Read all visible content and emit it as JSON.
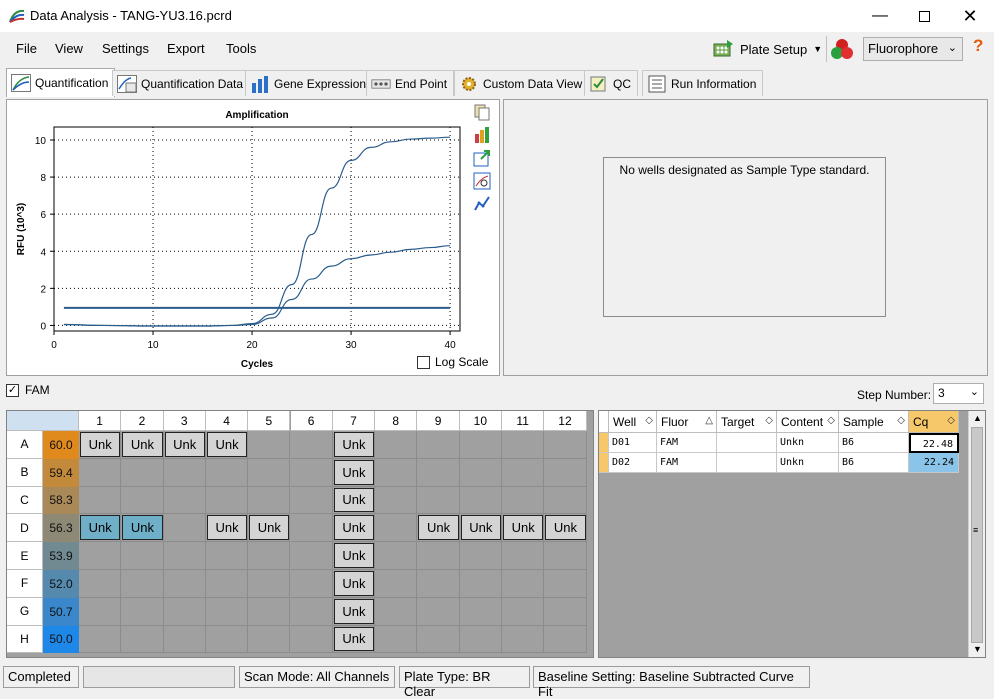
{
  "window": {
    "title": "Data Analysis - TANG-YU3.16.pcrd"
  },
  "menu": {
    "file": "File",
    "view": "View",
    "settings": "Settings",
    "export": "Export",
    "tools": "Tools"
  },
  "toolbar": {
    "plate_setup": "Plate Setup",
    "fluorophore": "Fluorophore"
  },
  "tabs": [
    "Quantification",
    "Quantification Data",
    "Gene Expression",
    "End Point",
    "Custom Data View",
    "QC",
    "Run Information"
  ],
  "chart_data": {
    "type": "line",
    "title": "Amplification",
    "xlabel": "Cycles",
    "ylabel": "RFU (10^3)",
    "xlim": [
      0,
      41
    ],
    "ylim": [
      -0.3,
      10.7
    ],
    "xticks": [
      0,
      10,
      20,
      30,
      40
    ],
    "yticks": [
      0,
      2,
      4,
      6,
      8,
      10
    ],
    "grid": true,
    "threshold": 0.95,
    "series": [
      {
        "x": [
          1,
          5,
          10,
          15,
          18,
          20,
          22,
          24,
          26,
          28,
          30,
          32,
          34,
          36,
          38,
          40
        ],
        "values": [
          0.05,
          0.0,
          -0.03,
          -0.03,
          0.0,
          0.1,
          0.6,
          2.2,
          4.9,
          7.4,
          8.9,
          9.6,
          9.9,
          10.05,
          10.1,
          10.15
        ]
      },
      {
        "x": [
          1,
          5,
          10,
          15,
          18,
          20,
          22,
          24,
          26,
          28,
          30,
          32,
          34,
          36,
          38,
          40
        ],
        "values": [
          0.05,
          0.0,
          -0.03,
          -0.03,
          0.0,
          0.05,
          0.4,
          1.4,
          2.5,
          3.2,
          3.6,
          3.8,
          3.95,
          4.1,
          4.2,
          4.3
        ]
      }
    ]
  },
  "log_scale_label": "Log Scale",
  "standard_curve_message": "No wells designated as Sample Type standard.",
  "fam_label": "FAM",
  "step_number": {
    "label": "Step Number:",
    "value": "3"
  },
  "plate": {
    "columns": [
      "1",
      "2",
      "3",
      "4",
      "5",
      "6",
      "7",
      "8",
      "9",
      "10",
      "11",
      "12"
    ],
    "rows": [
      "A",
      "B",
      "C",
      "D",
      "E",
      "F",
      "G",
      "H"
    ],
    "temps": [
      "60.0",
      "59.4",
      "58.3",
      "56.3",
      "53.9",
      "52.0",
      "50.7",
      "50.0"
    ],
    "well_label": "Unk",
    "wells": [
      {
        "row": 0,
        "col": 0
      },
      {
        "row": 0,
        "col": 1
      },
      {
        "row": 0,
        "col": 2
      },
      {
        "row": 0,
        "col": 3
      },
      {
        "row": 0,
        "col": 6
      },
      {
        "row": 1,
        "col": 6
      },
      {
        "row": 2,
        "col": 6
      },
      {
        "row": 3,
        "col": 0,
        "selected": true
      },
      {
        "row": 3,
        "col": 1,
        "selected": true
      },
      {
        "row": 3,
        "col": 3
      },
      {
        "row": 3,
        "col": 4
      },
      {
        "row": 3,
        "col": 6
      },
      {
        "row": 3,
        "col": 8
      },
      {
        "row": 3,
        "col": 9
      },
      {
        "row": 3,
        "col": 10
      },
      {
        "row": 3,
        "col": 11
      },
      {
        "row": 4,
        "col": 6
      },
      {
        "row": 5,
        "col": 6
      },
      {
        "row": 6,
        "col": 6
      },
      {
        "row": 7,
        "col": 6
      }
    ]
  },
  "table": {
    "headers": [
      "Well",
      "Fluor",
      "Target",
      "Content",
      "Sample",
      "Cq"
    ],
    "rows": [
      [
        "D01",
        "FAM",
        "",
        "Unkn",
        "B6",
        "22.48"
      ],
      [
        "D02",
        "FAM",
        "",
        "Unkn",
        "B6",
        "22.24"
      ]
    ]
  },
  "status": {
    "state": "Completed",
    "scan_mode": "Scan Mode: All Channels",
    "plate_type": "Plate Type: BR Clear",
    "baseline": "Baseline Setting: Baseline Subtracted Curve Fit"
  },
  "colors": {
    "temp_top": "#e08a1e",
    "temp_bottom": "#1e88e8",
    "selected_well": "#6fb0c8",
    "cq_highlight": "#8ac4e8",
    "curve": "#2a5d8c"
  }
}
